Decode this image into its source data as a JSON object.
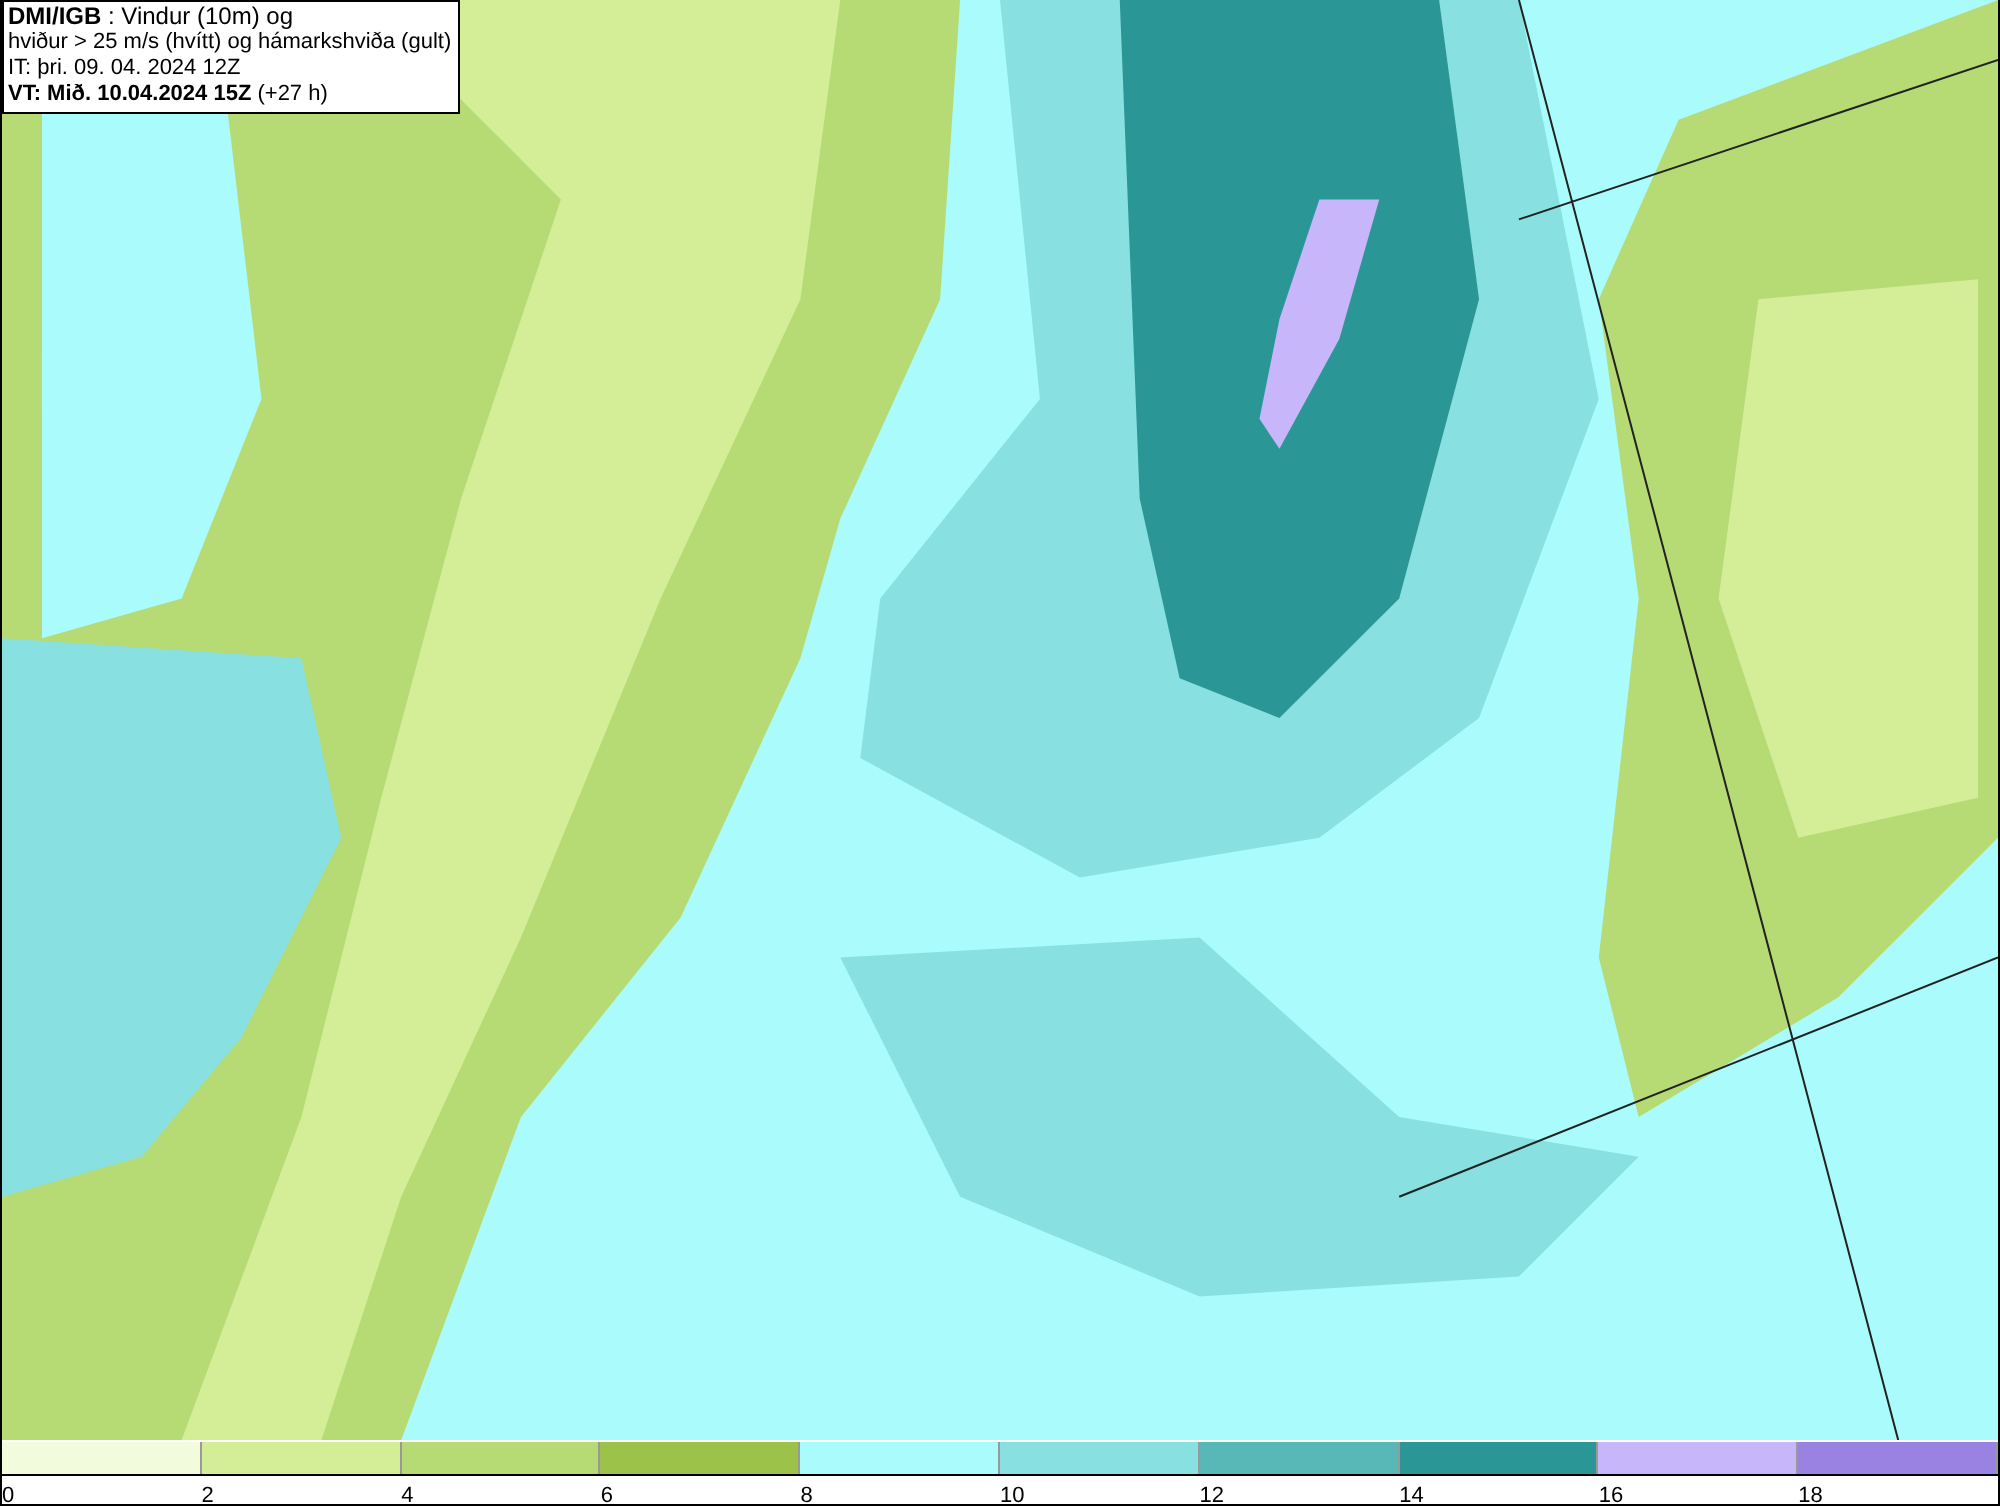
{
  "info_box": {
    "lines": [
      "**DMI/IGB** : Vindur (10m) og",
      "hviður > 25 m/s (hvítt) og hámarkshviða (gult)",
      "IT: þri. 09. 04. 2024 12Z",
      "**VT: Mið. 10.04.2024 15Z** (+27 h)"
    ]
  },
  "legend": {
    "segments": [
      {
        "label": "0",
        "color": "#f2fcdc"
      },
      {
        "label": "2",
        "color": "#d4ee98"
      },
      {
        "label": "4",
        "color": "#b6da74"
      },
      {
        "label": "6",
        "color": "#9cc24a"
      },
      {
        "label": "8",
        "color": "#aafcfc"
      },
      {
        "label": "10",
        "color": "#88e0e0"
      },
      {
        "label": "12",
        "color": "#58b8b8"
      },
      {
        "label": "14",
        "color": "#2a9696"
      },
      {
        "label": "16",
        "color": "#c8b6fa"
      },
      {
        "label": "18",
        "color": "#9a82e2"
      }
    ]
  }
}
